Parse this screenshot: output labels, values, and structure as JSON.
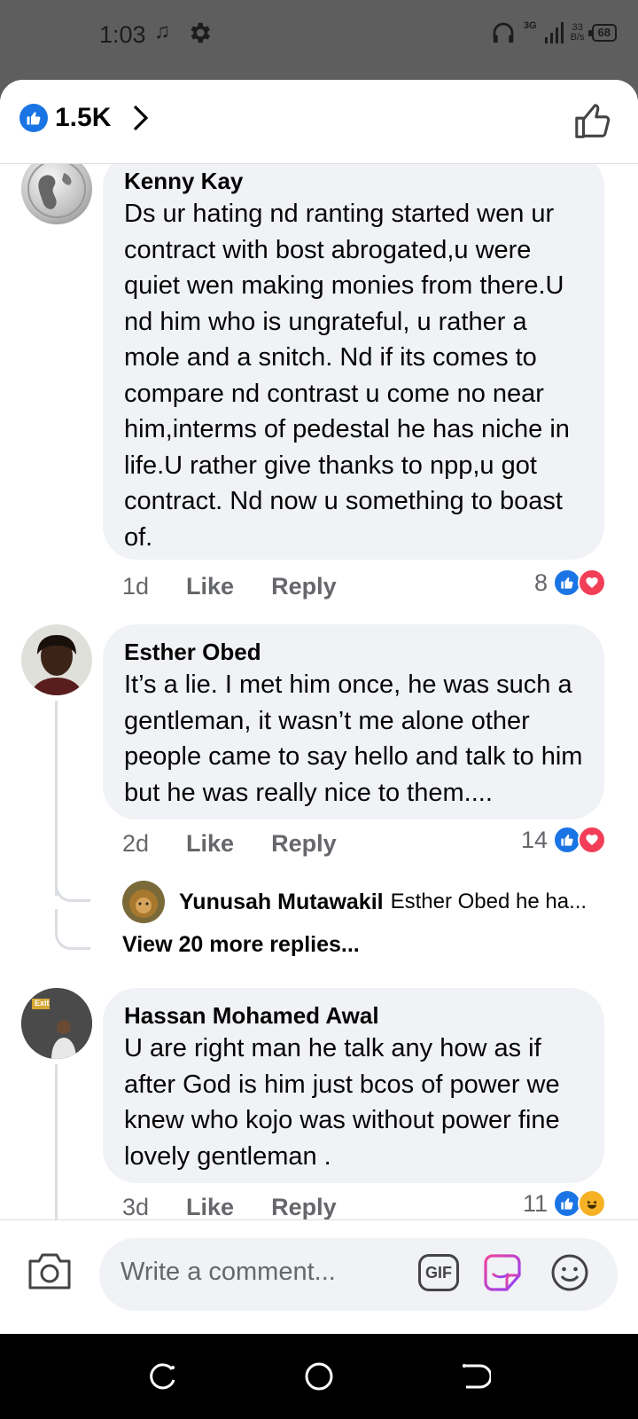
{
  "status_bar": {
    "time": "1:03",
    "music_glyph": "♫",
    "network": "3G",
    "speed_value": "33",
    "speed_unit": "B/s",
    "battery": "68"
  },
  "header": {
    "reaction_count": "1.5K"
  },
  "comments": [
    {
      "author": "Kenny Kay",
      "text": "Ds ur hating nd ranting started wen ur contract with bost abrogated,u were quiet wen making monies from there.U nd him who is ungrateful, u rather a mole and a snitch. Nd if its comes to compare nd contrast u come no near him,interms of pedestal he has niche in life.U rather give thanks to npp,u got contract. Nd now u something to boast of.",
      "age": "1d",
      "like_label": "Like",
      "reply_label": "Reply",
      "reactions": "8"
    },
    {
      "author": "Esther Obed",
      "text": "It’s a lie. I met him once, he was such a gentleman, it wasn’t me alone other people came to say hello and talk to him but he was really nice to them....",
      "age": "2d",
      "like_label": "Like",
      "reply_label": "Reply",
      "reactions": "14",
      "reply_preview": {
        "author": "Yunusah Mutawakil",
        "text": "Esther Obed he ha..."
      },
      "view_more": "View 20 more replies..."
    },
    {
      "author": "Hassan Mohamed Awal",
      "text": "U are right man he talk any how as if after God is him just bcos of power we knew who kojo was without power fine lovely gentleman .",
      "age": "3d",
      "like_label": "Like",
      "reply_label": "Reply",
      "reactions": "11",
      "avatar_sign": "Exit"
    }
  ],
  "composer": {
    "placeholder": "Write a comment...",
    "gif_label": "GIF"
  },
  "colors": {
    "brand_blue": "#1b74e4",
    "heart_red": "#f33e58",
    "haha_yellow": "#f7b125",
    "bubble_bg": "#f0f2f5",
    "meta_grey": "#65676b"
  }
}
